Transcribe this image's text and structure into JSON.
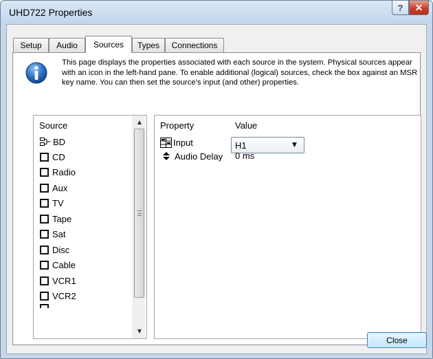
{
  "window": {
    "title": "UHD722 Properties",
    "help_glyph": "?",
    "close_glyph": "✕"
  },
  "tabs": [
    {
      "label": "Setup",
      "active": false
    },
    {
      "label": "Audio",
      "active": false
    },
    {
      "label": "Sources",
      "active": true
    },
    {
      "label": "Types",
      "active": false
    },
    {
      "label": "Connections",
      "active": false
    }
  ],
  "info": {
    "text": "This page displays the properties associated with each source in the system. Physical sources appear with an icon in the left-hand pane. To enable additional (logical) sources, check the box against an MSR key name. You can then set the source's input (and other) properties.",
    "icon": "info-icon"
  },
  "source_list": {
    "header": "Source",
    "items": [
      {
        "label": "BD",
        "kind": "physical",
        "icon": "source-device-icon"
      },
      {
        "label": "CD",
        "kind": "checkbox",
        "checked": false
      },
      {
        "label": "Radio",
        "kind": "checkbox",
        "checked": false
      },
      {
        "label": "Aux",
        "kind": "checkbox",
        "checked": false
      },
      {
        "label": "TV",
        "kind": "checkbox",
        "checked": false
      },
      {
        "label": "Tape",
        "kind": "checkbox",
        "checked": false
      },
      {
        "label": "Sat",
        "kind": "checkbox",
        "checked": false
      },
      {
        "label": "Disc",
        "kind": "checkbox",
        "checked": false
      },
      {
        "label": "Cable",
        "kind": "checkbox",
        "checked": false
      },
      {
        "label": "VCR1",
        "kind": "checkbox",
        "checked": false
      },
      {
        "label": "VCR2",
        "kind": "checkbox",
        "checked": false
      }
    ]
  },
  "properties": {
    "col_property": "Property",
    "col_value": "Value",
    "rows": [
      {
        "name": "Input",
        "icon": "input-table-icon",
        "value": "H1",
        "editor": "dropdown"
      },
      {
        "name": "Audio Delay",
        "icon": "spinner-updown-icon",
        "value": "0 ms",
        "editor": "text"
      }
    ]
  },
  "footer": {
    "close_label": "Close"
  },
  "colors": {
    "window_frame": "#c7d7e9",
    "close_caption": "#c4402a",
    "info_icon": "#2a6fc0",
    "default_button_border": "#3c7fb1"
  }
}
